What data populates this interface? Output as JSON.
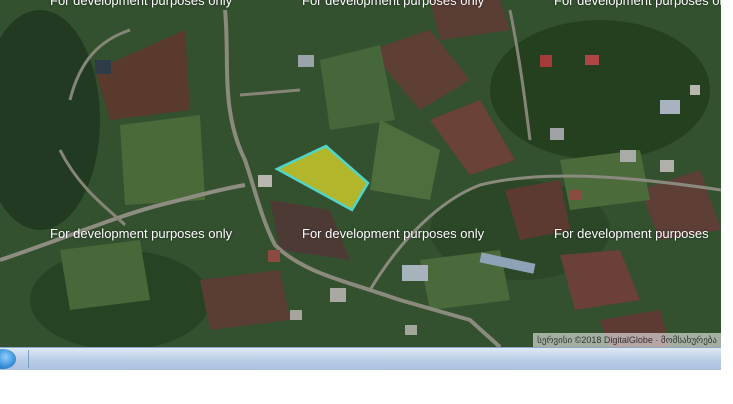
{
  "map": {
    "watermark_text": "For development purposes only",
    "watermark_text_truncated": "For development purposes",
    "attribution": "სერვისი ©2018 DigitalGlobe · მომსახურება",
    "parcel_fill": "#d6d42a",
    "parcel_stroke": "#4fd6c8"
  },
  "taskbar": {
    "start_icon": "windows-start-orb-icon"
  }
}
